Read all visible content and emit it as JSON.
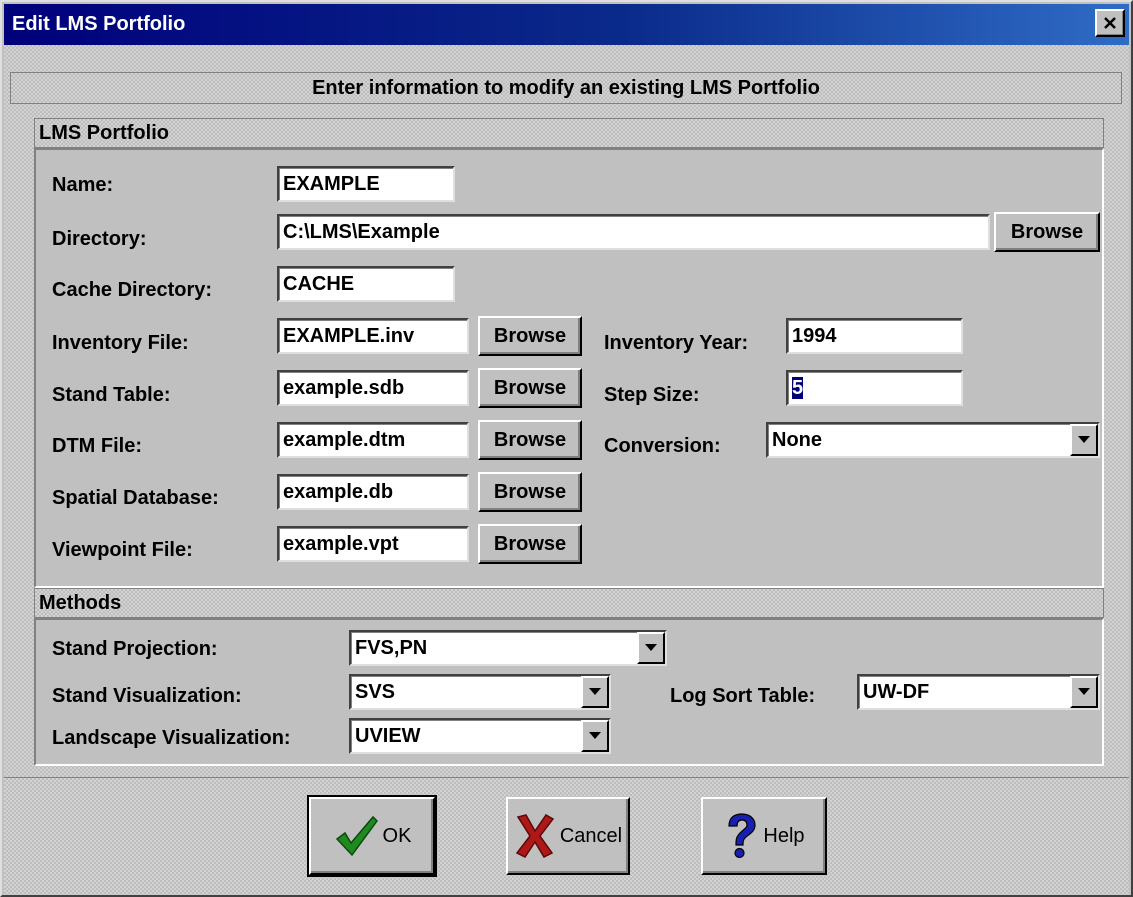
{
  "window": {
    "title": "Edit LMS Portfolio"
  },
  "header": {
    "text": "Enter information to modify an existing LMS Portfolio"
  },
  "portfolio": {
    "section_label": "LMS Portfolio",
    "name": {
      "label": "Name:",
      "value": "EXAMPLE"
    },
    "directory": {
      "label": "Directory:",
      "value": "C:\\LMS\\Example",
      "browse": "Browse"
    },
    "cache_directory": {
      "label": "Cache Directory:",
      "value": "CACHE"
    },
    "inventory_file": {
      "label": "Inventory File:",
      "value": "EXAMPLE.inv",
      "browse": "Browse"
    },
    "stand_table": {
      "label": "Stand Table:",
      "value": "example.sdb",
      "browse": "Browse"
    },
    "dtm_file": {
      "label": "DTM File:",
      "value": "example.dtm",
      "browse": "Browse"
    },
    "spatial_database": {
      "label": "Spatial Database:",
      "value": "example.db",
      "browse": "Browse"
    },
    "viewpoint_file": {
      "label": "Viewpoint File:",
      "value": "example.vpt",
      "browse": "Browse"
    },
    "inventory_year": {
      "label": "Inventory Year:",
      "value": "1994"
    },
    "step_size": {
      "label": "Step Size:",
      "value": "5"
    },
    "conversion": {
      "label": "Conversion:",
      "value": "None"
    }
  },
  "methods": {
    "section_label": "Methods",
    "stand_projection": {
      "label": "Stand Projection:",
      "value": "FVS,PN"
    },
    "stand_visualization": {
      "label": "Stand Visualization:",
      "value": "SVS"
    },
    "landscape_visualization": {
      "label": "Landscape Visualization:",
      "value": "UVIEW"
    },
    "log_sort_table": {
      "label": "Log Sort Table:",
      "value": "UW-DF"
    }
  },
  "footer": {
    "ok_label": "OK",
    "cancel_label": "Cancel",
    "help_label": "Help"
  },
  "icons": {
    "close": "close-icon",
    "dropdown": "chevron-down-icon",
    "ok": "checkmark-icon",
    "cancel": "x-icon",
    "help": "question-mark-icon"
  },
  "colors": {
    "titlebar_start": "#00007b",
    "titlebar_end": "#2f6cc6",
    "ok_check": "#1f8a1f",
    "cancel_x": "#b01818",
    "help_mark": "#1820b0"
  }
}
